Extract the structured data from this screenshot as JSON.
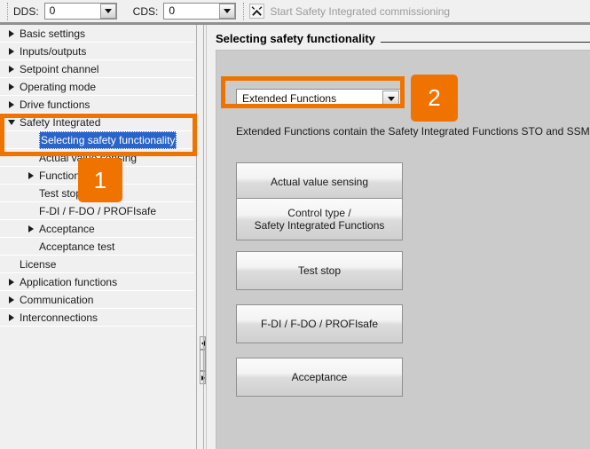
{
  "toolbar": {
    "dds_label": "DDS:",
    "dds_value": "0",
    "cds_label": "CDS:",
    "cds_value": "0",
    "action_label": "Start Safety Integrated commissioning",
    "action_icon": "tools-icon"
  },
  "tree": {
    "items": [
      {
        "label": "Basic settings",
        "indent": 0,
        "twisty": "right",
        "selected": false
      },
      {
        "label": "Inputs/outputs",
        "indent": 0,
        "twisty": "right",
        "selected": false
      },
      {
        "label": "Setpoint channel",
        "indent": 0,
        "twisty": "right",
        "selected": false
      },
      {
        "label": "Operating mode",
        "indent": 0,
        "twisty": "right",
        "selected": false
      },
      {
        "label": "Drive functions",
        "indent": 0,
        "twisty": "right",
        "selected": false
      },
      {
        "label": "Safety Integrated",
        "indent": 0,
        "twisty": "down",
        "selected": false
      },
      {
        "label": "Selecting safety functionality",
        "indent": 1,
        "twisty": "none",
        "selected": true
      },
      {
        "label": "Actual value sensing",
        "indent": 1,
        "twisty": "none",
        "selected": false
      },
      {
        "label": "Functions",
        "indent": 1,
        "twisty": "right",
        "selected": false
      },
      {
        "label": "Test stop",
        "indent": 1,
        "twisty": "none",
        "selected": false
      },
      {
        "label": "F-DI / F-DO / PROFIsafe",
        "indent": 1,
        "twisty": "none",
        "selected": false
      },
      {
        "label": "Acceptance",
        "indent": 1,
        "twisty": "right",
        "selected": false
      },
      {
        "label": "Acceptance test",
        "indent": 1,
        "twisty": "none",
        "selected": false
      },
      {
        "label": "License",
        "indent": 0,
        "twisty": "none",
        "selected": false
      },
      {
        "label": "Application functions",
        "indent": 0,
        "twisty": "right",
        "selected": false
      },
      {
        "label": "Communication",
        "indent": 0,
        "twisty": "right",
        "selected": false
      },
      {
        "label": "Interconnections",
        "indent": 0,
        "twisty": "right",
        "selected": false
      }
    ]
  },
  "content": {
    "title": "Selecting safety functionality",
    "function_select_value": "Extended Functions",
    "description": "Extended Functions contain the Safety Integrated Functions STO and SSM.",
    "buttons": [
      {
        "label": "Actual value sensing"
      },
      {
        "label": "Control type /\nSafety Integrated Functions"
      },
      {
        "label": "Test stop"
      },
      {
        "label": "F-DI / F-DO / PROFIsafe"
      },
      {
        "label": "Acceptance"
      }
    ]
  },
  "annotations": {
    "accent_color": "#f07300",
    "badges": [
      {
        "label": "1"
      },
      {
        "label": "2"
      }
    ]
  }
}
